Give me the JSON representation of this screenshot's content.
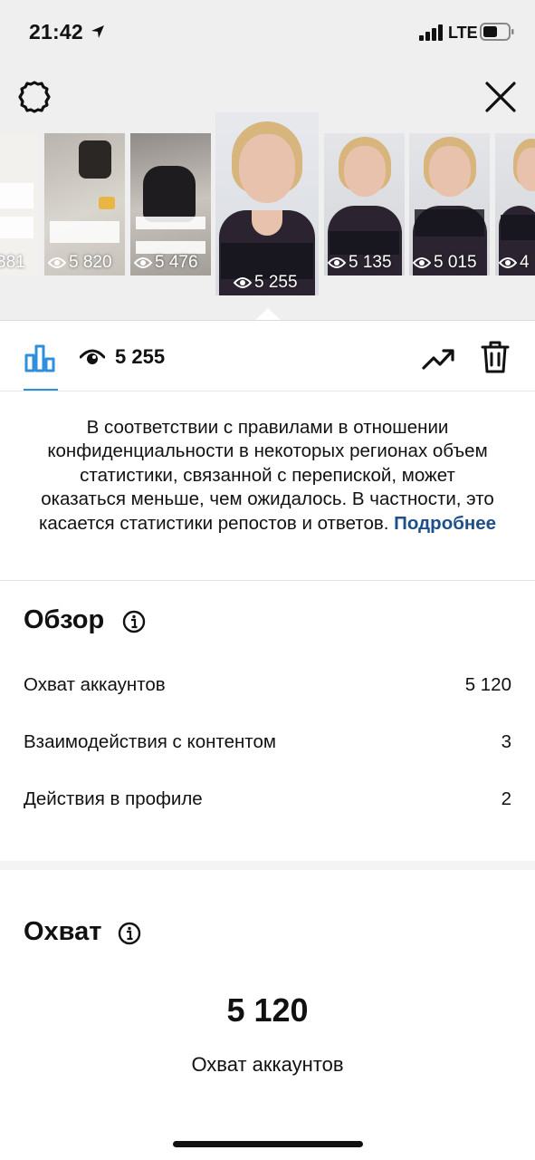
{
  "status_bar": {
    "time": "21:42",
    "network": "LTE"
  },
  "story_thumbnails": [
    {
      "views": "381"
    },
    {
      "views": "5 820"
    },
    {
      "views": "5 476"
    },
    {
      "views": "5 255",
      "selected": true
    },
    {
      "views": "5 135"
    },
    {
      "views": "5 015"
    },
    {
      "views": "4"
    }
  ],
  "toolbar": {
    "views_count": "5 255"
  },
  "notice": {
    "text": "В соответствии с правилами в отношении конфиденциальности в некоторых регионах объем статистики, связанной с перепиской, может оказаться меньше, чем ожидалось. В частности, это касается статистики репостов и ответов.",
    "link_label": "Подробнее"
  },
  "overview": {
    "title": "Обзор",
    "rows": [
      {
        "label": "Охват аккаунтов",
        "value": "5 120"
      },
      {
        "label": "Взаимодействия с контентом",
        "value": "3"
      },
      {
        "label": "Действия в профиле",
        "value": "2"
      }
    ]
  },
  "reach": {
    "title": "Охват",
    "number": "5 120",
    "label": "Охват аккаунтов"
  },
  "colors": {
    "accent": "#2f8fdc",
    "link": "#1f4f8a",
    "top_bg": "#efefef"
  }
}
